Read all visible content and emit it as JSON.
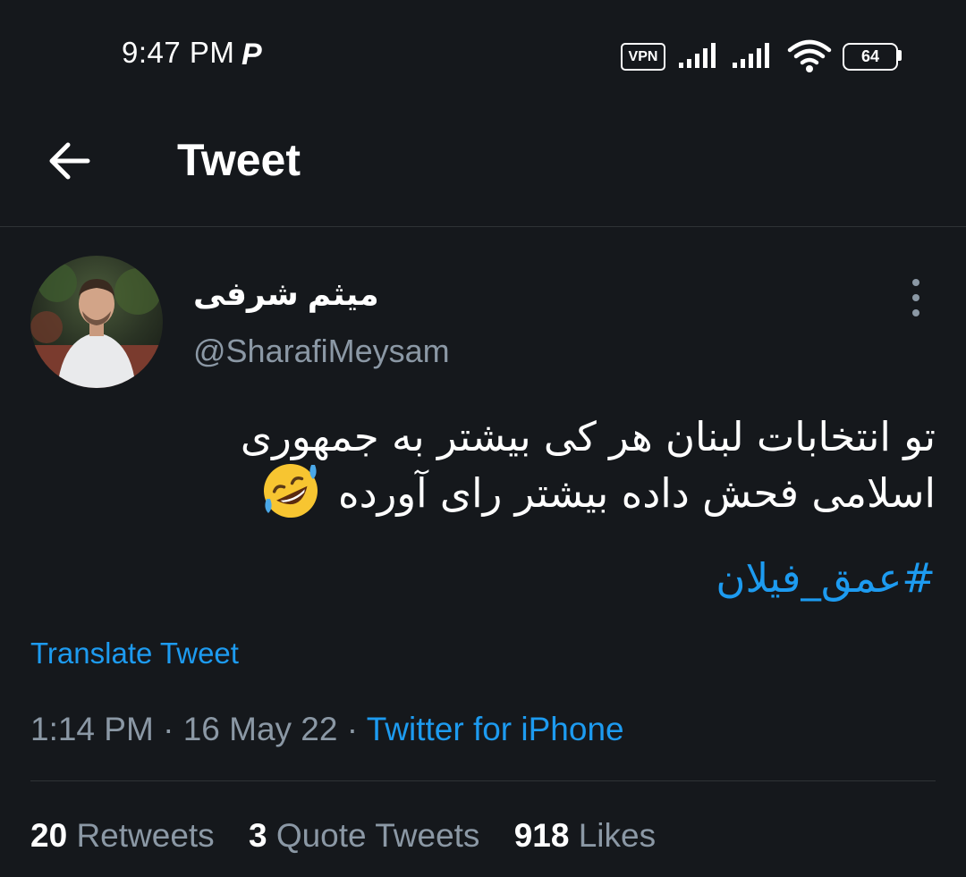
{
  "status_bar": {
    "time": "9:47 PM",
    "app_indicator": "P",
    "vpn_label": "VPN",
    "battery_level": "64",
    "icons": [
      "vpn-icon",
      "signal-icon",
      "signal-icon",
      "wifi-icon",
      "battery-icon"
    ]
  },
  "header": {
    "back_icon": "back-arrow-icon",
    "title": "Tweet"
  },
  "tweet": {
    "author": {
      "display_name": "میثم شرفی",
      "handle": "@SharafiMeysam",
      "avatar": "avatar-photo"
    },
    "more_icon": "more-vertical-icon",
    "text_line_1": "تو انتخابات لبنان هر کی بیشتر به جمهوری",
    "text_line_2": "اسلامی فحش داده بیشتر رای آورده",
    "emoji": "rolling-on-floor-laughing-emoji",
    "hashtag": "#عمق_فیلان",
    "translate_label": "Translate Tweet",
    "time": "1:14 PM",
    "separator": "·",
    "date": "16 May 22",
    "source": "Twitter for iPhone"
  },
  "stats": {
    "retweets_count": "20",
    "retweets_label": "Retweets",
    "quotes_count": "3",
    "quotes_label": "Quote Tweets",
    "likes_count": "918",
    "likes_label": "Likes"
  },
  "colors": {
    "background": "#15181c",
    "text_primary": "#ffffff",
    "text_secondary": "#8b98a5",
    "accent": "#1d9bf0",
    "divider": "#2f3336"
  }
}
